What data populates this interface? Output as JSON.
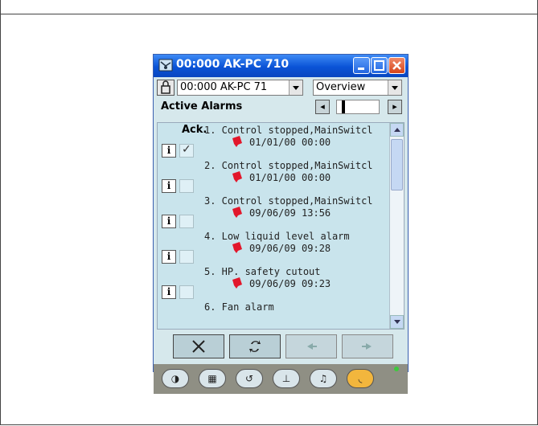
{
  "window": {
    "title": "00:000 AK-PC 710",
    "icon": "network-icon"
  },
  "controls": {
    "device_combo": "00:000 AK-PC 71",
    "view_combo": "Overview"
  },
  "heading": "Active Alarms",
  "list": {
    "ack_header": "Ack.",
    "rows": [
      {
        "line1": "1. Control stopped,MainSwitcl",
        "line2": "01/01/00 00:00",
        "acked": true
      },
      {
        "line1": "2. Control stopped,MainSwitcl",
        "line2": "01/01/00 00:00",
        "acked": false
      },
      {
        "line1": "3. Control stopped,MainSwitcl",
        "line2": "09/06/09 13:56",
        "acked": false
      },
      {
        "line1": "4. Low liquid level alarm",
        "line2": "09/06/09 09:28",
        "acked": false
      },
      {
        "line1": "5. HP. safety cutout",
        "line2": "09/06/09 09:23",
        "acked": false
      },
      {
        "line1": "6. Fan alarm",
        "line2": "",
        "acked": false
      }
    ]
  },
  "actions": {
    "clear": "✕",
    "refresh": "⇅",
    "prev": "◂",
    "next": "▸"
  },
  "toolbar": {
    "items": [
      "◑",
      "▦",
      "↺",
      "⊥",
      "♫",
      "◟"
    ]
  },
  "colors": {
    "titlebar": "#0a53d6",
    "alarm_bell": "#e2172b",
    "active_tool": "#f2b63d"
  }
}
